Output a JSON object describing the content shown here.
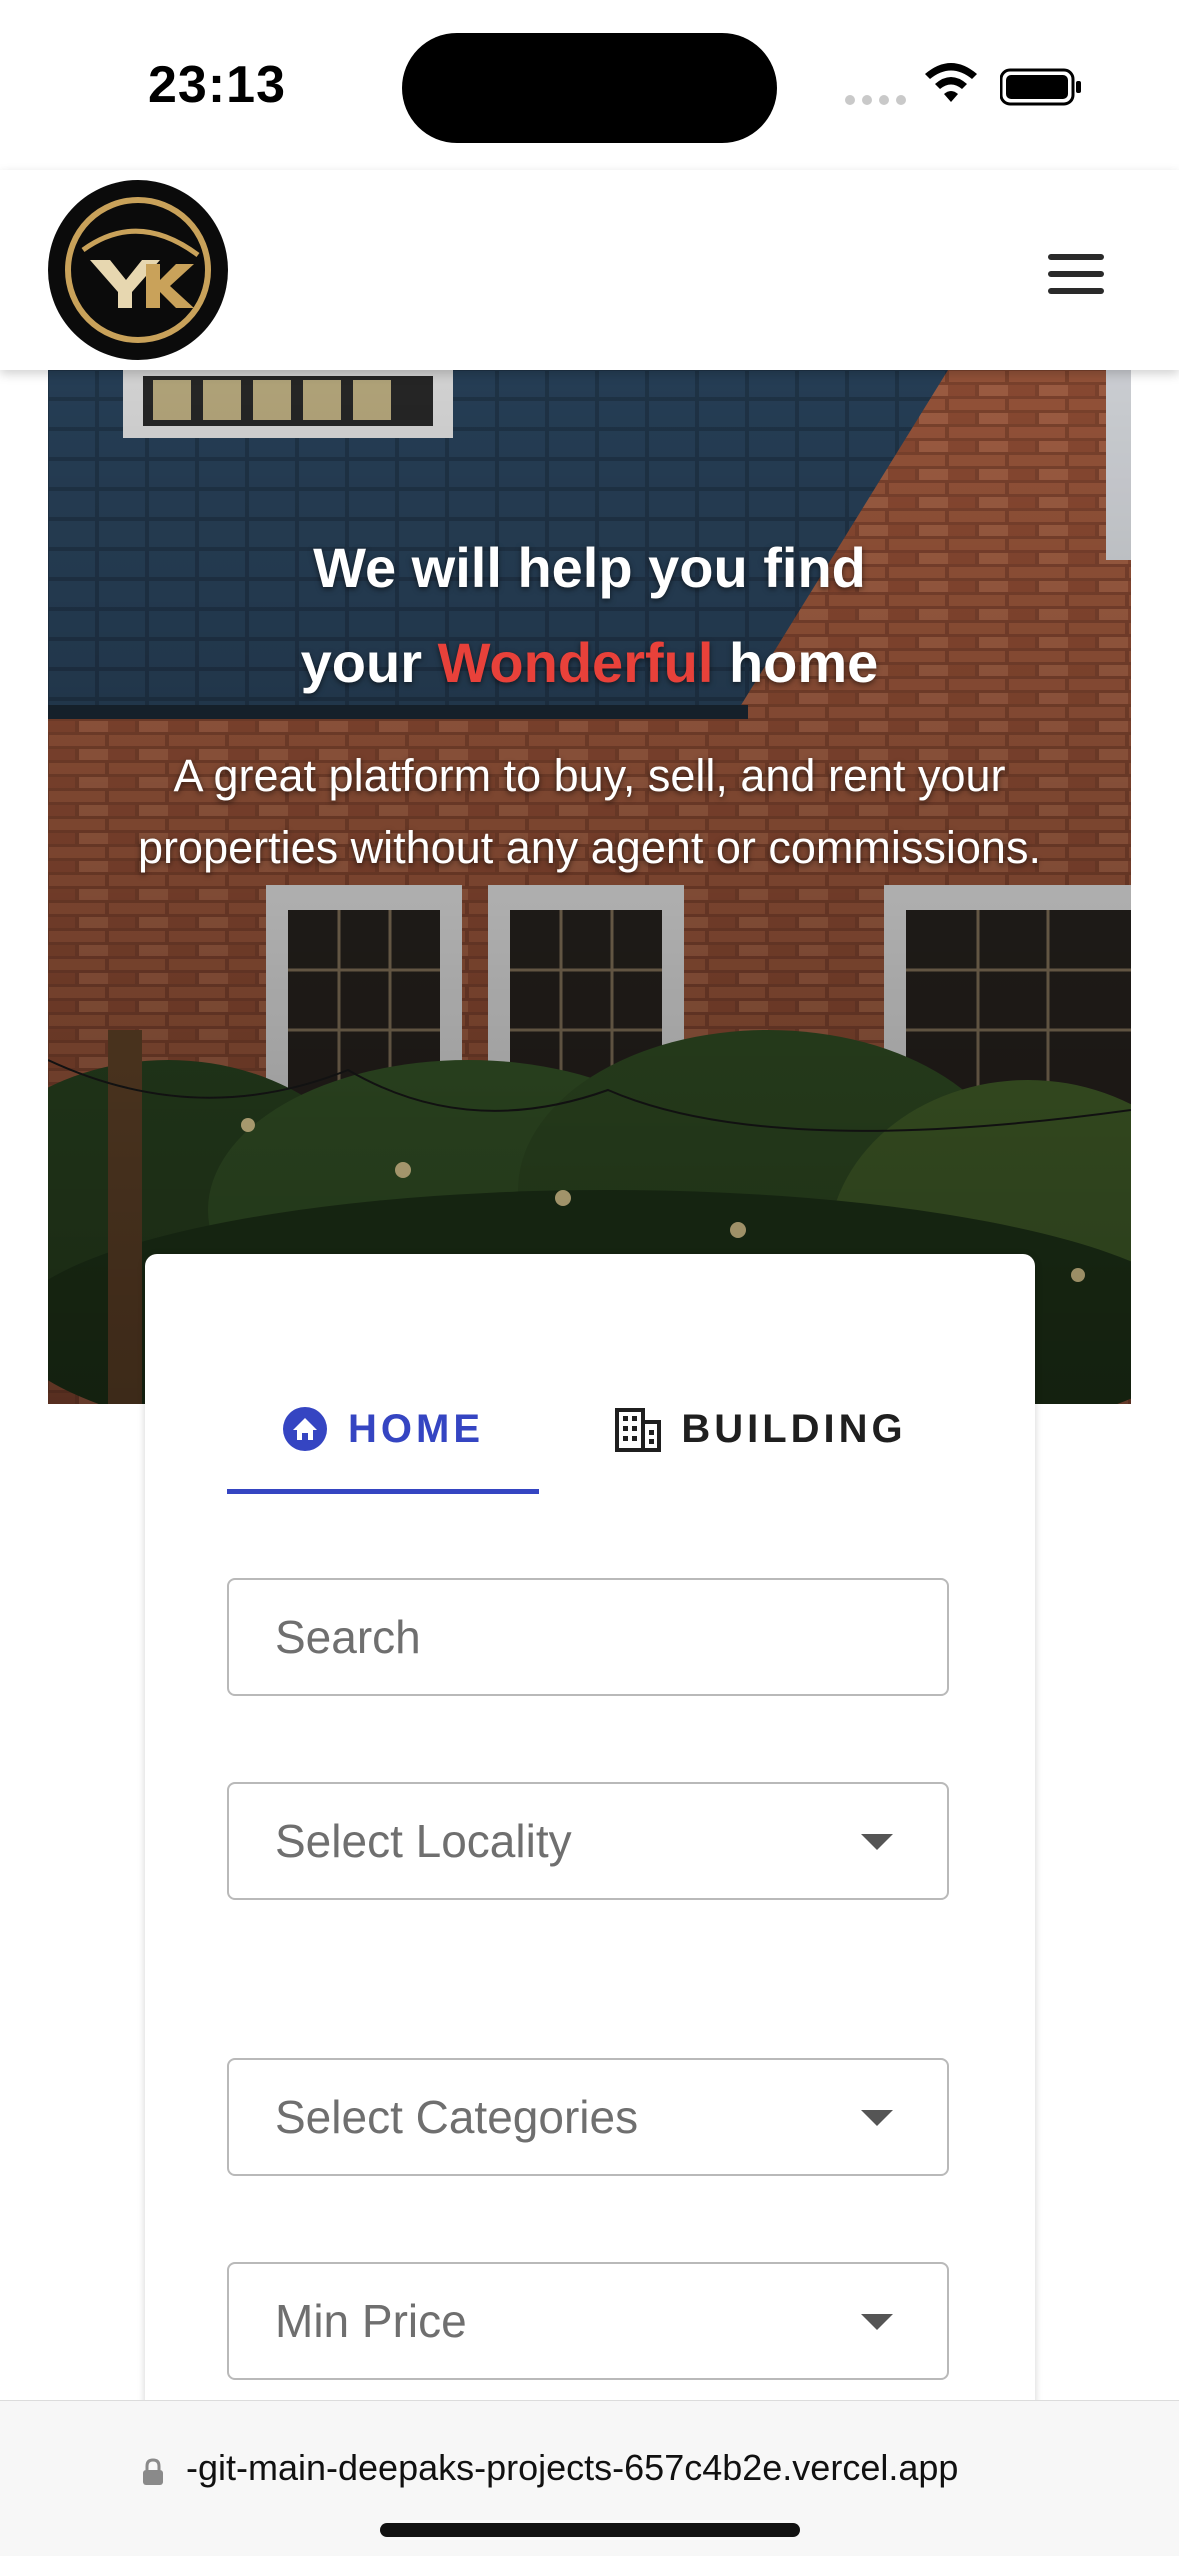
{
  "status_bar": {
    "time": "23:13"
  },
  "header": {
    "logo_text": "YK",
    "menu_icon": "hamburger-icon"
  },
  "hero": {
    "title_line1": "We will help you find",
    "title_line2_prefix": "your",
    "title_line2_accent": "Wonderful",
    "title_line2_suffix": "home",
    "subtitle_line1": "A great platform to buy, sell, and rent your",
    "subtitle_line2": "properties without any agent or commissions.",
    "accent_color": "#e8413a"
  },
  "search": {
    "tabs": [
      {
        "label": "HOME",
        "icon": "house-icon",
        "active": true
      },
      {
        "label": "BUILDING",
        "icon": "building-icon",
        "active": false
      }
    ],
    "search_placeholder": "Search",
    "locality_placeholder": "Select Locality",
    "categories_placeholder": "Select Categories",
    "min_price_placeholder": "Min Price",
    "active_color": "#3545c2"
  },
  "browser": {
    "url": "-git-main-deepaks-projects-657c4b2e.vercel.app"
  }
}
